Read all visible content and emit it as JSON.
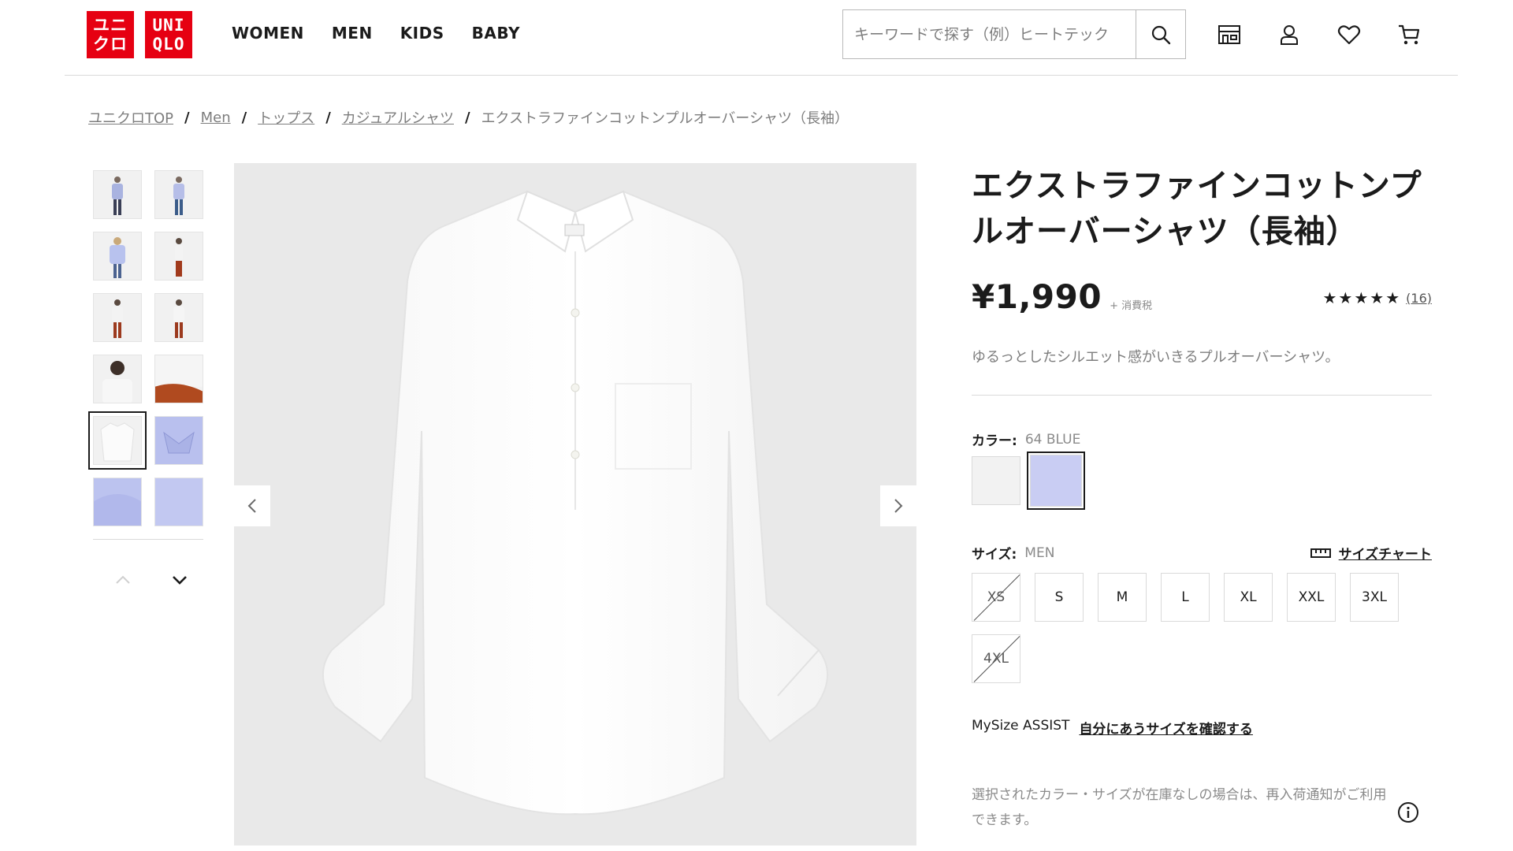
{
  "header": {
    "logo_top": "UNI",
    "logo_bottom": "QLO",
    "logo_kana_top": "ユニ",
    "logo_kana_bottom": "クロ",
    "nav": [
      "WOMEN",
      "MEN",
      "KIDS",
      "BABY"
    ],
    "search_placeholder": "キーワードで探す（例）ヒートテック",
    "icons": [
      "store-icon",
      "user-icon",
      "heart-icon",
      "cart-icon"
    ]
  },
  "breadcrumb": [
    {
      "label": "ユニクロTOP",
      "link": true
    },
    {
      "label": "Men",
      "link": true
    },
    {
      "label": "トップス",
      "link": true
    },
    {
      "label": "カジュアルシャツ",
      "link": true
    },
    {
      "label": "エクストラファインコットンプルオーバーシャツ（長袖）",
      "link": false
    }
  ],
  "breadcrumb_sep": "/",
  "product": {
    "title": "エクストラファインコットンプルオーバーシャツ（長袖）",
    "price": "¥1,990",
    "tax_note": "+ 消費税",
    "rating_stars": "★★★★★",
    "rating_value": 4.5,
    "review_count": "(16)",
    "description": "ゆるっとしたシルエット感がいきるプルオーバーシャツ。",
    "color_label": "カラー:",
    "color_value": "64 BLUE",
    "colors": [
      {
        "name": "white",
        "hex": "#f2f2f2",
        "selected": false
      },
      {
        "name": "blue",
        "hex": "#c9cdf3",
        "selected": true
      }
    ],
    "size_label": "サイズ:",
    "size_value": "MEN",
    "size_chart": "サイズチャート",
    "sizes": [
      {
        "label": "XS",
        "available": false
      },
      {
        "label": "S",
        "available": true
      },
      {
        "label": "M",
        "available": true
      },
      {
        "label": "L",
        "available": true
      },
      {
        "label": "XL",
        "available": true
      },
      {
        "label": "XXL",
        "available": true
      },
      {
        "label": "3XL",
        "available": true
      },
      {
        "label": "4XL",
        "available": false
      }
    ],
    "mysize_label": "MySize ASSIST",
    "mysize_link": "自分にあうサイズを確認する",
    "notify_text": "選択されたカラー・サイズが在庫なしの場合は、再入荷通知がご利用できます。"
  },
  "gallery": {
    "selected_index": 8,
    "thumb_count": 12
  },
  "colors": {
    "brand_red": "#e60012",
    "text": "#1b1b1b",
    "muted": "#7d7d7d",
    "border": "#dadada"
  }
}
